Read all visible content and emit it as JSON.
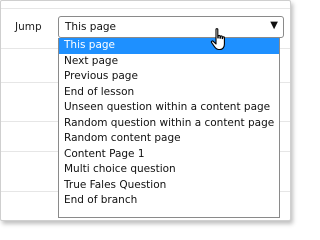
{
  "field": {
    "label": "Jump",
    "selected_value": "This page"
  },
  "options": [
    "This page",
    "Next page",
    "Previous page",
    "End of lesson",
    "Unseen question within a content page",
    "Random question within a content page",
    "Random content page",
    "Content Page 1",
    "Multi choice question",
    "True Fales Question",
    "End of branch"
  ],
  "colors": {
    "highlight": "#1e90ff"
  },
  "icons": {
    "dropdown_caret": "caret-down-icon",
    "cursor": "hand-pointer-icon"
  }
}
